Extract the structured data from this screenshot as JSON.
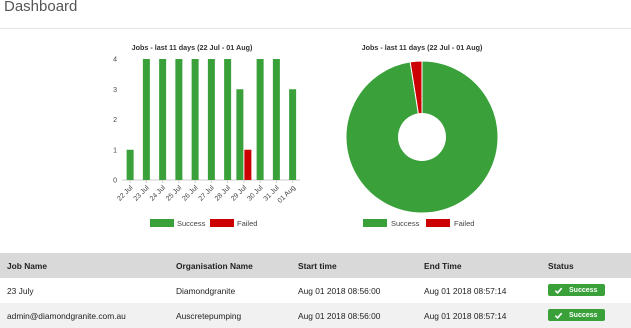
{
  "page": {
    "title": "Dashboard"
  },
  "colors": {
    "success": "#3aa13a",
    "failed": "#cc0000",
    "header_bg": "#d9d9d9"
  },
  "chart_data": [
    {
      "type": "bar",
      "title": "Jobs - last 11 days (22 Jul - 01 Aug)",
      "categories": [
        "22 Jul",
        "23 Jul",
        "24 Jul",
        "25 Jul",
        "26 Jul",
        "27 Jul",
        "28 Jul",
        "29 Jul",
        "30 Jul",
        "31 Jul",
        "01 Aug"
      ],
      "series": [
        {
          "name": "Success",
          "color": "#3aa13a",
          "values": [
            1,
            4,
            4,
            4,
            4,
            4,
            4,
            3,
            4,
            4,
            3
          ]
        },
        {
          "name": "Failed",
          "color": "#cc0000",
          "values": [
            0,
            0,
            0,
            0,
            0,
            0,
            0,
            1,
            0,
            0,
            0
          ]
        }
      ],
      "ylim": [
        0,
        4
      ],
      "yticks": [
        "0",
        "1",
        "2",
        "3",
        "4"
      ],
      "grid": false,
      "legend": "bottom"
    },
    {
      "type": "pie",
      "title": "Jobs - last 11 days (22 Jul - 01 Aug)",
      "slices": [
        {
          "name": "Success",
          "color": "#3aa13a",
          "value": 39
        },
        {
          "name": "Failed",
          "color": "#cc0000",
          "value": 1
        }
      ],
      "donut": true,
      "legend": "bottom"
    }
  ],
  "table": {
    "headers": [
      "Job Name",
      "Organisation Name",
      "Start time",
      "End Time",
      "Status"
    ],
    "rows": [
      {
        "job": "23 July",
        "org": "Diamondgranite",
        "start": "Aug 01 2018 08:56:00",
        "end": "Aug 01 2018 08:57:14",
        "status": "Success"
      },
      {
        "job": "admin@diamondgranite.com.au",
        "org": "Auscretepumping",
        "start": "Aug 01 2018 08:56:00",
        "end": "Aug 01 2018 08:57:14",
        "status": "Success"
      }
    ]
  }
}
